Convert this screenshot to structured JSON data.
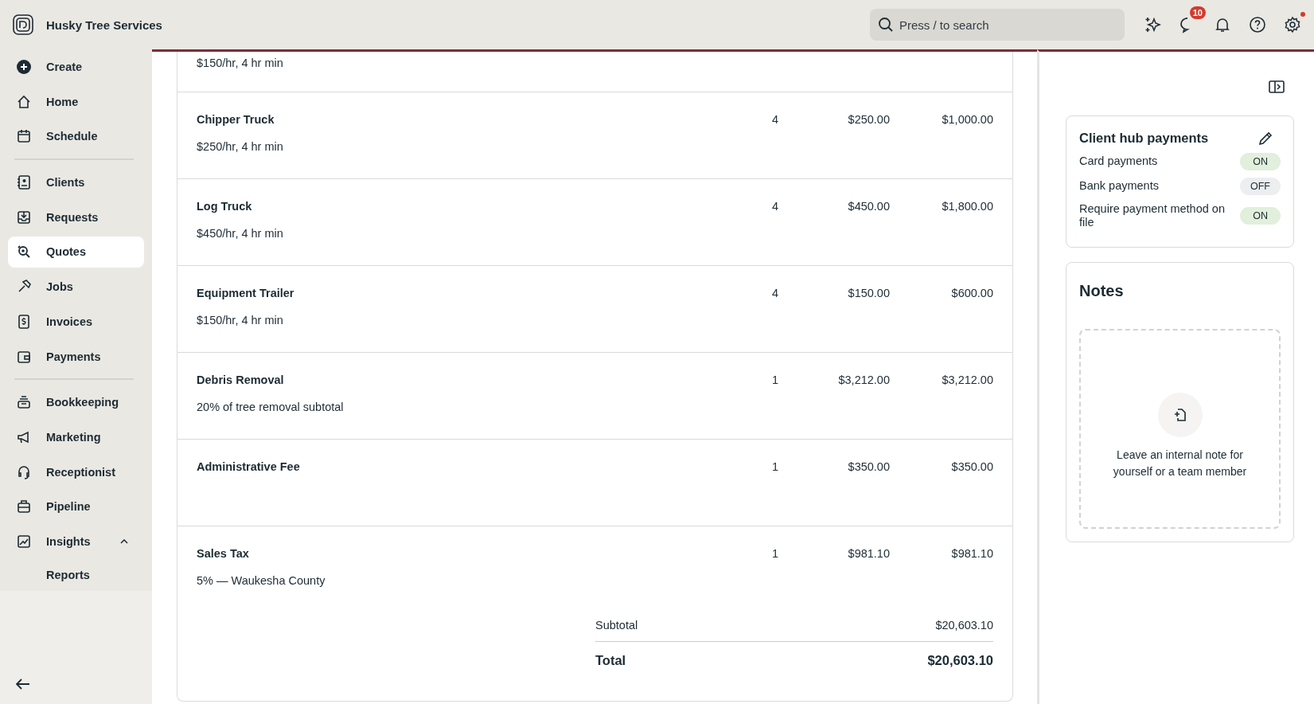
{
  "topbar": {
    "company": "Husky Tree Services",
    "search": {
      "placeholder": "Press / to search"
    },
    "messages_badge": "10",
    "settings_alert": true
  },
  "sidebar": {
    "groups": [
      [
        {
          "label": "Create",
          "selected": false
        },
        {
          "label": "Home",
          "selected": false
        },
        {
          "label": "Schedule",
          "selected": false
        }
      ],
      [
        {
          "label": "Clients",
          "selected": false
        },
        {
          "label": "Requests",
          "selected": false
        },
        {
          "label": "Quotes",
          "selected": true
        },
        {
          "label": "Jobs",
          "selected": false
        },
        {
          "label": "Invoices",
          "selected": false
        },
        {
          "label": "Payments",
          "selected": false
        }
      ],
      [
        {
          "label": "Bookkeeping",
          "selected": false
        },
        {
          "label": "Marketing",
          "selected": false
        },
        {
          "label": "Receptionist",
          "selected": false
        },
        {
          "label": "Pipeline",
          "selected": false
        },
        {
          "label": "Insights",
          "selected": false,
          "expanded": true,
          "children": [
            {
              "label": "Reports",
              "selected": false
            }
          ]
        }
      ]
    ]
  },
  "line_items": [
    {
      "description": "$150/hr, 4 hr min"
    },
    {
      "name": "Chipper Truck",
      "description": "$250/hr, 4 hr min",
      "quantity": "4",
      "unit_price": "$250.00",
      "total": "$1,000.00"
    },
    {
      "name": "Log Truck",
      "description": "$450/hr, 4 hr min",
      "quantity": "4",
      "unit_price": "$450.00",
      "total": "$1,800.00"
    },
    {
      "name": "Equipment Trailer",
      "description": "$150/hr, 4 hr min",
      "quantity": "4",
      "unit_price": "$150.00",
      "total": "$600.00"
    },
    {
      "name": "Debris Removal",
      "description": "20% of tree removal subtotal",
      "quantity": "1",
      "unit_price": "$3,212.00",
      "total": "$3,212.00"
    },
    {
      "name": "Administrative Fee",
      "quantity": "1",
      "unit_price": "$350.00",
      "total": "$350.00"
    },
    {
      "name": "Sales Tax",
      "description": "5% — Waukesha County",
      "quantity": "1",
      "unit_price": "$981.10",
      "total": "$981.10"
    }
  ],
  "totals": {
    "subtotal_label": "Subtotal",
    "subtotal": "$20,603.10",
    "total_label": "Total",
    "total": "$20,603.10"
  },
  "client_hub_payments": {
    "title": "Client hub payments",
    "settings": [
      {
        "label": "Card payments",
        "on": true,
        "status": "ON"
      },
      {
        "label": "Bank payments",
        "on": false,
        "status": "OFF"
      },
      {
        "label": "Require payment method on file",
        "on": true,
        "status": "ON"
      }
    ]
  },
  "notes": {
    "title": "Notes",
    "empty_text": "Leave an internal note for yourself or a team member"
  }
}
